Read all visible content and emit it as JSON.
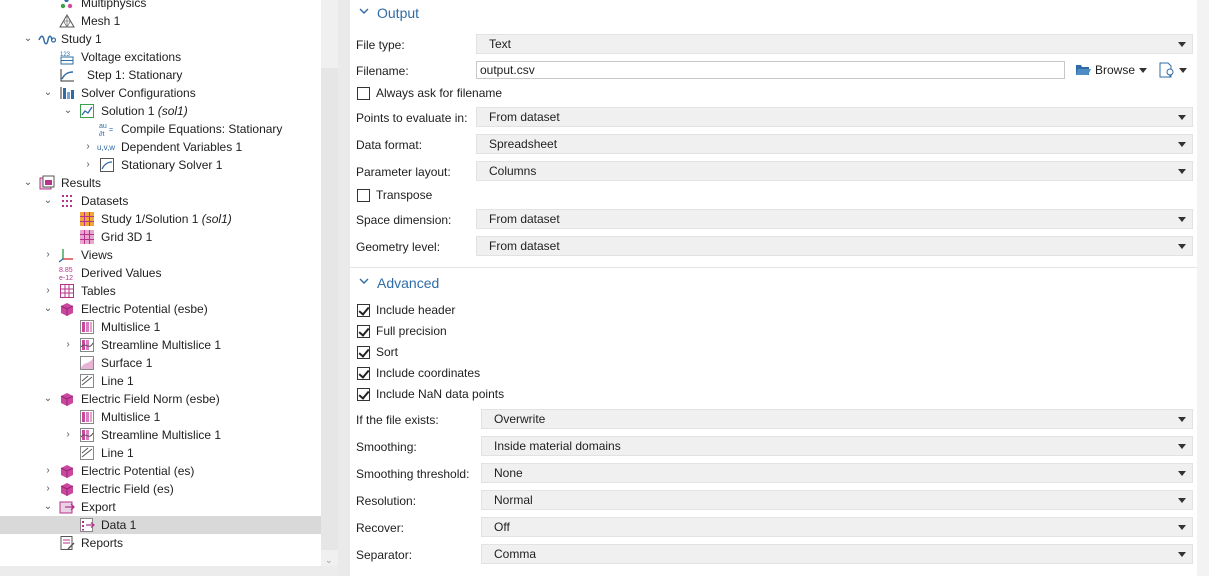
{
  "tree": {
    "items": [
      {
        "label": "Multiphysics",
        "icon": "multiphysics-icon"
      },
      {
        "label": "Mesh 1",
        "icon": "mesh-icon"
      },
      {
        "label": "Study 1",
        "icon": "study-icon"
      },
      {
        "label": "Voltage excitations",
        "icon": "parameter-table-icon"
      },
      {
        "label": "Step 1: Stationary",
        "icon": "stationary-step-icon"
      },
      {
        "label": "Solver Configurations",
        "icon": "solver-configurations-icon"
      },
      {
        "label": "Solution 1",
        "tag": "(sol1)",
        "icon": "solution-icon"
      },
      {
        "label": "Compile Equations: Stationary",
        "icon": "compile-equations-icon"
      },
      {
        "label": "Dependent Variables 1",
        "icon": "dependent-variables-icon"
      },
      {
        "label": "Stationary Solver 1",
        "icon": "stationary-solver-icon"
      },
      {
        "label": "Results",
        "icon": "results-icon"
      },
      {
        "label": "Datasets",
        "icon": "datasets-icon"
      },
      {
        "label": "Study 1/Solution 1",
        "tag": "(sol1)",
        "icon": "solution-dataset-icon"
      },
      {
        "label": "Grid 3D 1",
        "icon": "grid-3d-icon"
      },
      {
        "label": "Views",
        "icon": "views-icon"
      },
      {
        "label": "Derived Values",
        "icon": "derived-values-icon"
      },
      {
        "label": "Tables",
        "icon": "tables-icon"
      },
      {
        "label": "Electric Potential (esbe)",
        "icon": "plot-group-3d-icon"
      },
      {
        "label": "Multislice 1",
        "icon": "multislice-icon"
      },
      {
        "label": "Streamline Multislice 1",
        "icon": "streamline-multislice-icon"
      },
      {
        "label": "Surface 1",
        "icon": "surface-icon"
      },
      {
        "label": "Line 1",
        "icon": "line-plot-icon"
      },
      {
        "label": "Electric Field Norm (esbe)",
        "icon": "plot-group-3d-icon"
      },
      {
        "label": "Multislice 1",
        "icon": "multislice-icon"
      },
      {
        "label": "Streamline Multislice 1",
        "icon": "streamline-multislice-icon"
      },
      {
        "label": "Line 1",
        "icon": "line-plot-icon"
      },
      {
        "label": "Electric Potential (es)",
        "icon": "plot-group-3d-icon"
      },
      {
        "label": "Electric Field (es)",
        "icon": "plot-group-3d-icon"
      },
      {
        "label": "Export",
        "icon": "export-icon"
      },
      {
        "label": "Data 1",
        "icon": "data-export-icon"
      },
      {
        "label": "Reports",
        "icon": "reports-icon"
      }
    ]
  },
  "output": {
    "title": "Output",
    "file_type_label": "File type:",
    "file_type_value": "Text",
    "filename_label": "Filename:",
    "filename_value": "output.csv",
    "browse_label": "Browse",
    "always_ask_label": "Always ask for filename",
    "always_ask_checked": false,
    "points_label": "Points to evaluate in:",
    "points_value": "From dataset",
    "data_format_label": "Data format:",
    "data_format_value": "Spreadsheet",
    "parameter_layout_label": "Parameter layout:",
    "parameter_layout_value": "Columns",
    "transpose_label": "Transpose",
    "transpose_checked": false,
    "space_dimension_label": "Space dimension:",
    "space_dimension_value": "From dataset",
    "geometry_level_label": "Geometry level:",
    "geometry_level_value": "From dataset"
  },
  "advanced": {
    "title": "Advanced",
    "include_header_label": "Include header",
    "full_precision_label": "Full precision",
    "sort_label": "Sort",
    "include_coordinates_label": "Include coordinates",
    "include_nan_label": "Include NaN data points",
    "if_file_exists_label": "If the file exists:",
    "if_file_exists_value": "Overwrite",
    "smoothing_label": "Smoothing:",
    "smoothing_value": "Inside material domains",
    "smoothing_threshold_label": "Smoothing threshold:",
    "smoothing_threshold_value": "None",
    "resolution_label": "Resolution:",
    "resolution_value": "Normal",
    "recover_label": "Recover:",
    "recover_value": "Off",
    "separator_label": "Separator:",
    "separator_value": "Comma"
  },
  "colors": {
    "accent": "#2f6ca6",
    "selection": "#d9d9d9",
    "plot_group_magenta": "#b5338a"
  }
}
